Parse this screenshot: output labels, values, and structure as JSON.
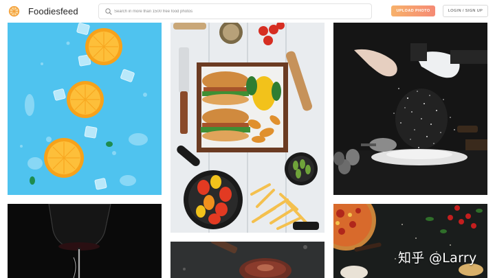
{
  "header": {
    "brand": "Foodiesfeed",
    "logo_icon": "orange-slice-icon",
    "search": {
      "placeholder": "Search in more than 1500 free food photos",
      "icon": "search-icon"
    },
    "upload_label": "UPLOAD PHOTO",
    "login_label": "LOGIN / SIGN UP"
  },
  "colors": {
    "accent_gradient_start": "#f7b16a",
    "accent_gradient_end": "#f58a74",
    "orange_photo_bg": "#4fc3ef",
    "wood_bg": "#e9ecef",
    "dark_bg": "#121212"
  },
  "photos": [
    {
      "id": "photo-orange-slices",
      "subject": "orange slices on blue background"
    },
    {
      "id": "photo-burger-tray",
      "subject": "burger and fries on white wood"
    },
    {
      "id": "photo-flour-hands",
      "subject": "hands sprinkling flour on dark"
    },
    {
      "id": "photo-wine-pour",
      "subject": "wine pouring into glass"
    },
    {
      "id": "photo-grilled-meat",
      "subject": "grilled meat on dark board"
    },
    {
      "id": "photo-pizza-dark",
      "subject": "pizza on dark table"
    }
  ],
  "watermark": "知乎 @Larry"
}
